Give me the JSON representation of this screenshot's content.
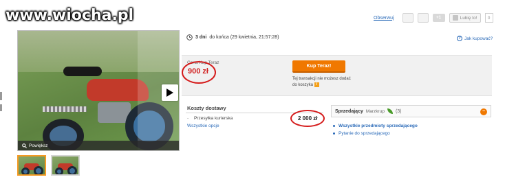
{
  "watermark": "www.wiocha.pl",
  "social": {
    "observe": "Obserwuj",
    "gplus": "+1",
    "fb_like": "Lubię to!",
    "fb_count": "0"
  },
  "gallery": {
    "zoom_label": "Powiększ",
    "thumbs": 2
  },
  "auction": {
    "time_bold": "3 dni",
    "time_rest": "do końca (29 kwietnia, 21:57:28)",
    "question_link": "Jak kupować?"
  },
  "price": {
    "label": "Cena Kup Teraz",
    "value": "900 zł",
    "buy_button": "Kup Teraz!",
    "note": "Tej transakcji nie możesz dodać do koszyka",
    "note_icon": "i"
  },
  "shipping": {
    "title": "Koszty dostawy",
    "item_dash": "-",
    "item_label": "Przesyłka kurierska",
    "item_price": "2 000 zł",
    "all_options": "Wszystkie opcje"
  },
  "seller": {
    "label": "Sprzedający",
    "name": "Marzkrup",
    "count": "(3)",
    "links": [
      "Wszystkie przedmioty sprzedającego",
      "Pytanie do sprzedającego"
    ]
  },
  "colors": {
    "accent_orange": "#f07800",
    "price_red": "#d12020",
    "link_blue": "#2a6ab8",
    "annotation_red": "#d51b1b"
  }
}
